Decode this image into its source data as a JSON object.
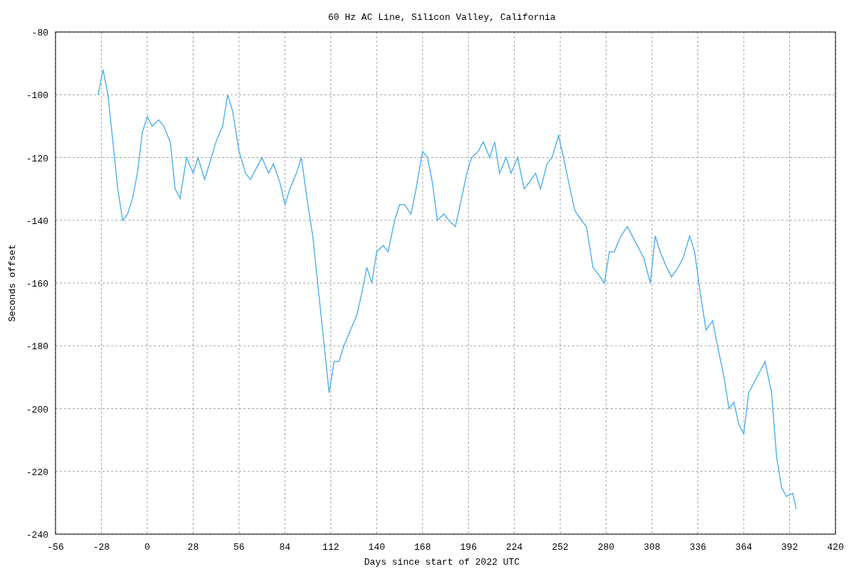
{
  "chart_data": {
    "type": "line",
    "title": "60 Hz AC Line, Silicon Valley, California",
    "xlabel": "Days since start of 2022 UTC",
    "ylabel": "Seconds offset",
    "grid": true,
    "xlim": [
      -56,
      420
    ],
    "ylim": [
      -240,
      -80
    ],
    "xticks": [
      -56,
      -28,
      0,
      28,
      56,
      84,
      112,
      140,
      168,
      196,
      224,
      252,
      280,
      308,
      336,
      364,
      392,
      420
    ],
    "yticks": [
      -240,
      -220,
      -200,
      -180,
      -160,
      -140,
      -120,
      -100,
      -80
    ],
    "x": [
      -30,
      -27,
      -24,
      -21,
      -18,
      -15,
      -12,
      -9,
      -6,
      -3,
      0,
      3,
      7,
      10,
      14,
      17,
      20,
      24,
      28,
      31,
      35,
      38,
      42,
      46,
      49,
      52,
      56,
      60,
      63,
      67,
      70,
      74,
      77,
      81,
      84,
      87,
      91,
      94,
      98,
      101,
      105,
      108,
      111,
      114,
      117,
      120,
      124,
      128,
      131,
      134,
      137,
      140,
      144,
      147,
      151,
      154,
      157,
      161,
      164,
      168,
      171,
      174,
      177,
      181,
      184,
      188,
      191,
      195,
      198,
      202,
      205,
      209,
      212,
      215,
      219,
      222,
      226,
      230,
      233,
      237,
      240,
      244,
      247,
      251,
      254,
      258,
      261,
      265,
      268,
      272,
      275,
      279,
      282,
      285,
      289,
      293,
      296,
      299,
      303,
      307,
      310,
      313,
      317,
      320,
      324,
      327,
      331,
      334,
      338,
      341,
      345,
      348,
      352,
      355,
      358,
      361,
      364,
      367,
      370,
      374,
      377,
      381,
      384,
      387,
      390,
      394,
      396
    ],
    "series": [
      {
        "color": "#56b4e9",
        "values": [
          -100,
          -92,
          -100,
          -115,
          -130,
          -140,
          -138,
          -133,
          -125,
          -112,
          -107,
          -110,
          -108,
          -110,
          -115,
          -130,
          -133,
          -120,
          -125,
          -120,
          -127,
          -122,
          -115,
          -110,
          -100,
          -105,
          -118,
          -125,
          -127,
          -123,
          -120,
          -125,
          -122,
          -128,
          -135,
          -130,
          -125,
          -120,
          -135,
          -145,
          -165,
          -180,
          -195,
          -185,
          -185,
          -180,
          -175,
          -170,
          -163,
          -155,
          -160,
          -150,
          -148,
          -150,
          -140,
          -135,
          -135,
          -138,
          -130,
          -118,
          -120,
          -128,
          -140,
          -138,
          -140,
          -142,
          -135,
          -125,
          -120,
          -118,
          -115,
          -120,
          -115,
          -125,
          -120,
          -125,
          -120,
          -130,
          -128,
          -125,
          -130,
          -122,
          -120,
          -113,
          -120,
          -130,
          -137,
          -140,
          -142,
          -155,
          -157,
          -160,
          -150,
          -150,
          -145,
          -142,
          -145,
          -148,
          -152,
          -160,
          -145,
          -150,
          -155,
          -158,
          -155,
          -152,
          -145,
          -150,
          -165,
          -175,
          -172,
          -180,
          -190,
          -200,
          -198,
          -205,
          -208,
          -195,
          -192,
          -188,
          -185,
          -195,
          -215,
          -225,
          -228,
          -227,
          -232
        ]
      }
    ]
  }
}
